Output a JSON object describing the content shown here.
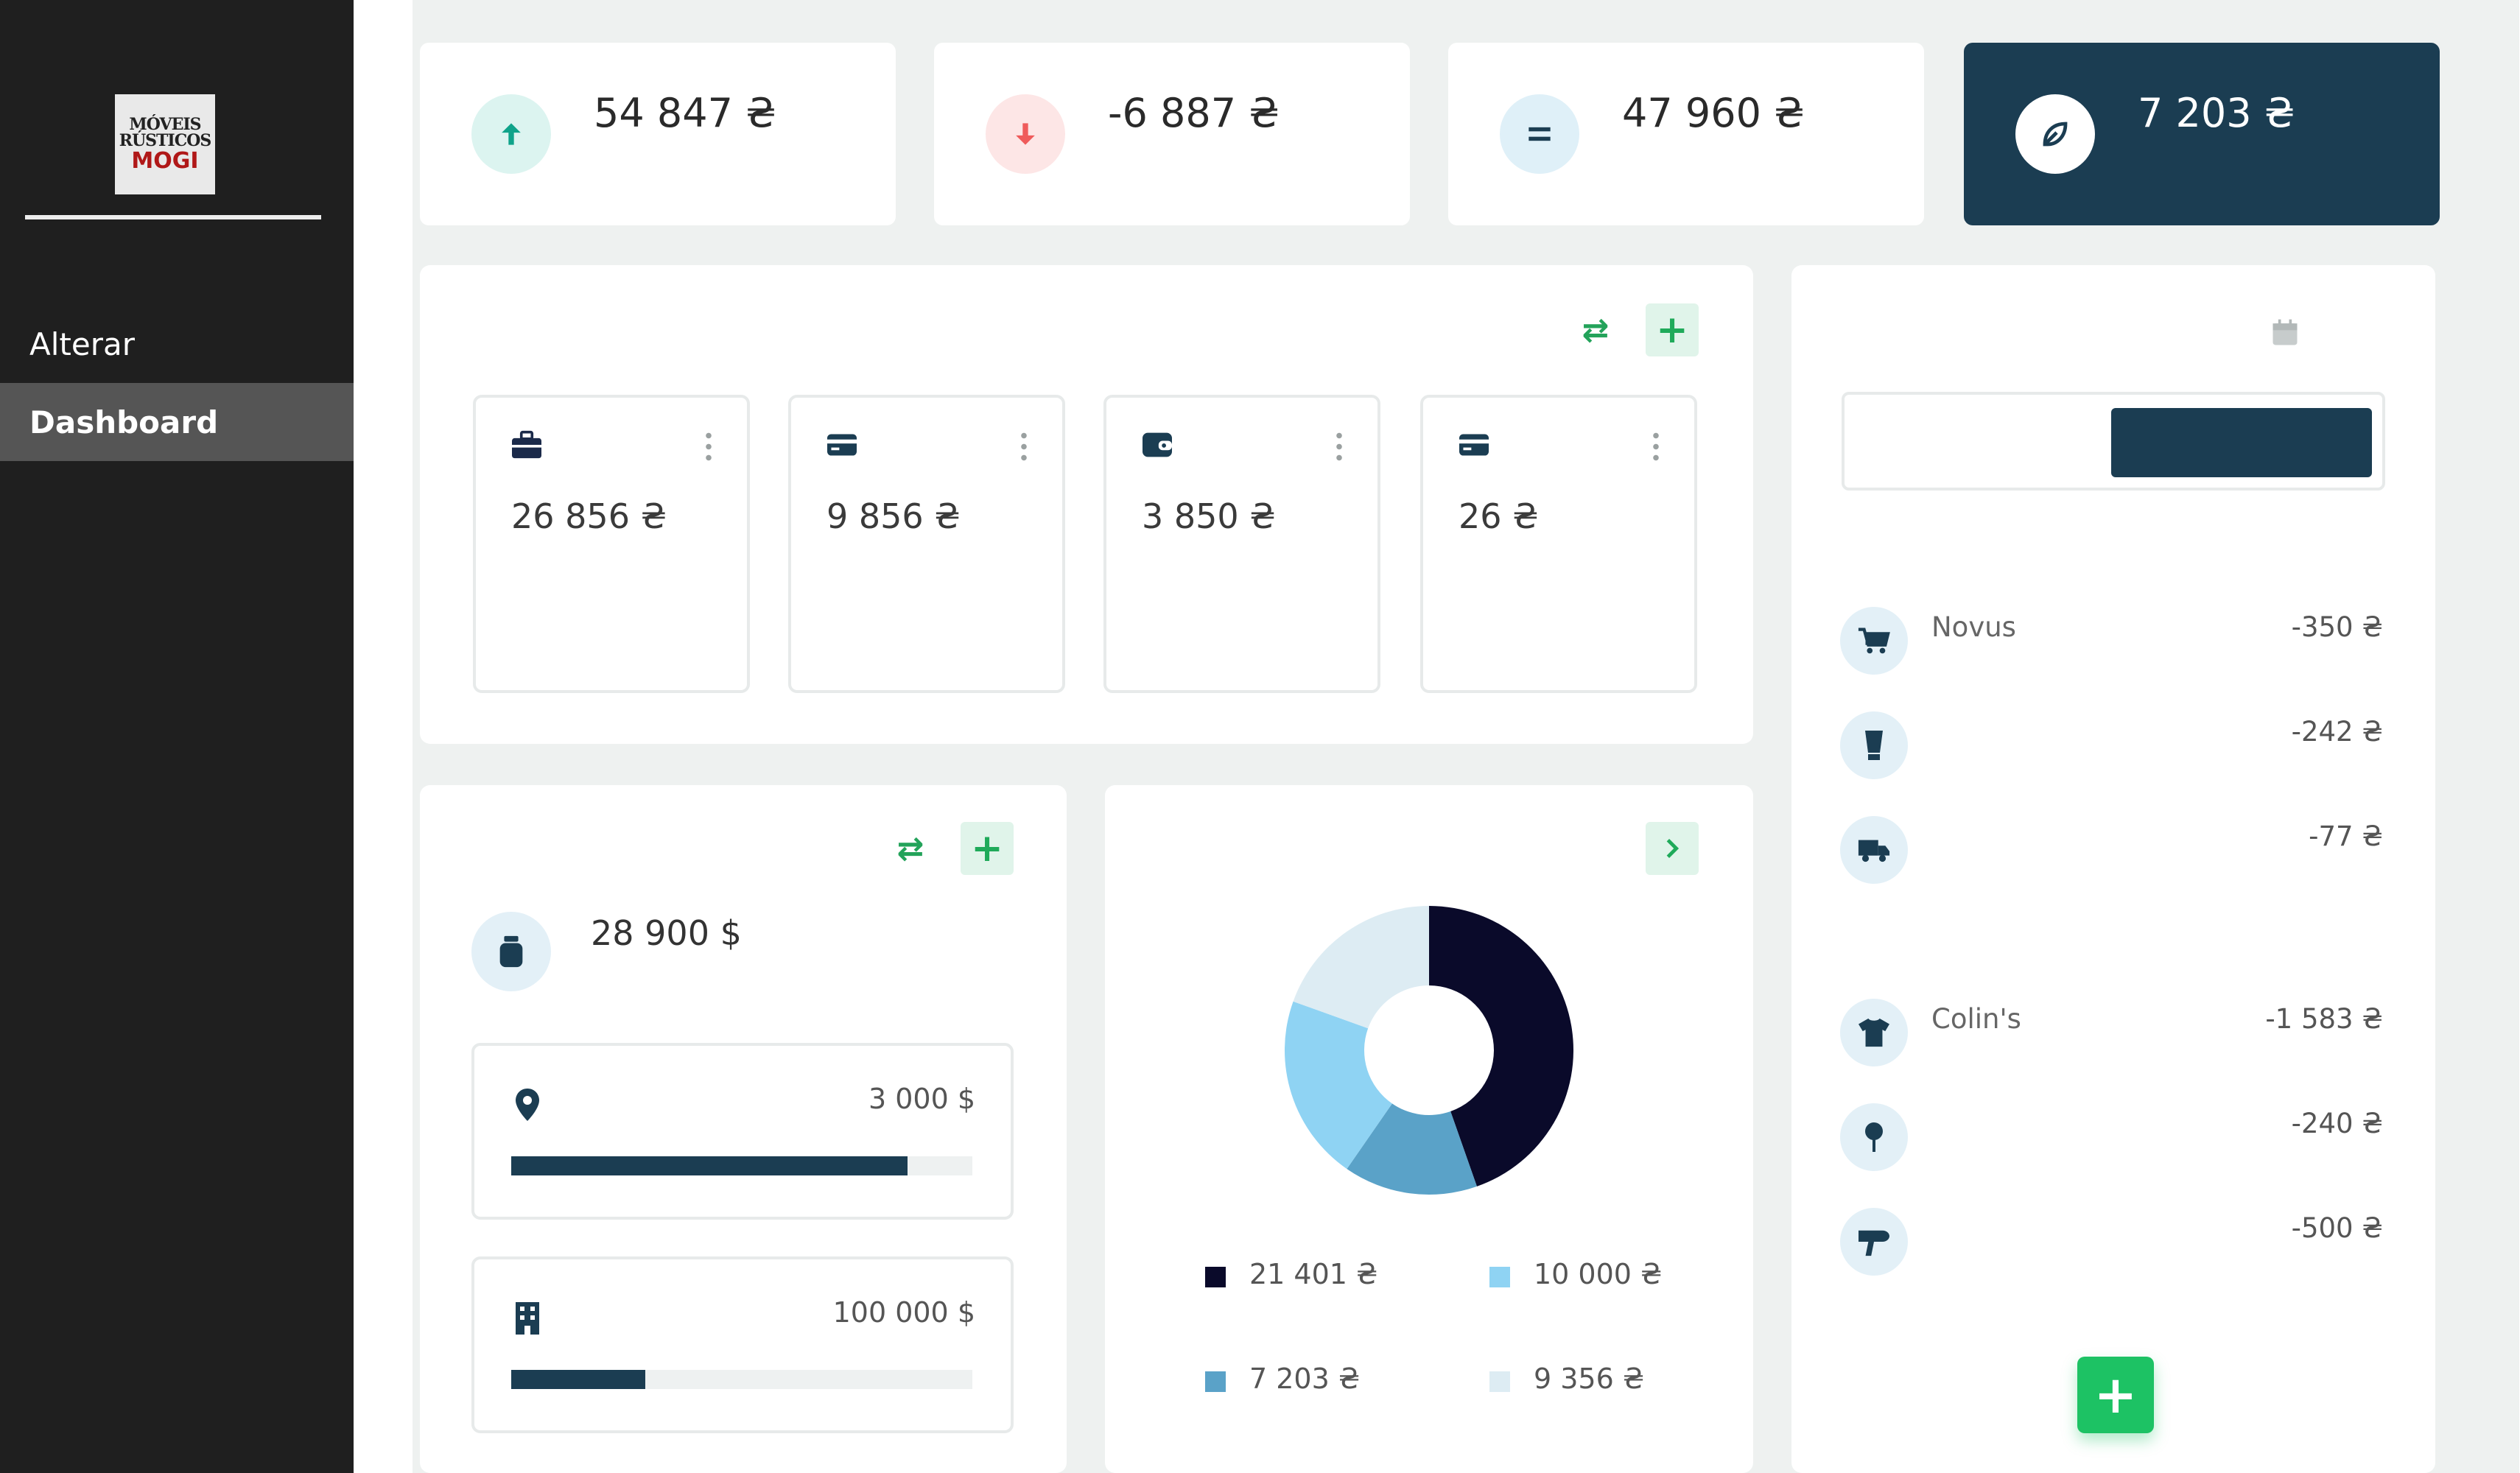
{
  "sidebar": {
    "logo": {
      "line1": "MÓVEIS",
      "line2": "RÚSTICOS",
      "line3": "MOGI"
    },
    "items": [
      {
        "label": "Alterar"
      },
      {
        "label": "Dashboard",
        "active": true
      }
    ]
  },
  "stats": [
    {
      "value": "54 847 ₴",
      "icon": "arrow-up-icon",
      "color": "#0fa38a"
    },
    {
      "value": "-6 887 ₴",
      "icon": "arrow-down-icon",
      "color": "#ef5b5b"
    },
    {
      "value": "47 960 ₴",
      "icon": "equals-icon",
      "color": "#1b3d52"
    },
    {
      "value": "7 203 ₴",
      "icon": "leaf-icon",
      "color": "#1b3d52"
    }
  ],
  "accounts": [
    {
      "icon": "briefcase-icon",
      "amount": "26 856 ₴"
    },
    {
      "icon": "card-icon",
      "amount": "9 856 ₴"
    },
    {
      "icon": "wallet-icon",
      "amount": "3 850 ₴"
    },
    {
      "icon": "card-icon",
      "amount": "26 ₴"
    }
  ],
  "savings": {
    "total": "28 900 $",
    "goals": [
      {
        "icon": "location-pin-icon",
        "amount": "3 000 $",
        "progress": 0.86
      },
      {
        "icon": "building-icon",
        "amount": "100 000 $",
        "progress": 0.29
      }
    ]
  },
  "chart_data": {
    "type": "pie",
    "labels": [
      "21 401 ₴",
      "7 203 ₴",
      "10 000 ₴",
      "9 356 ₴"
    ],
    "values": [
      21401,
      7203,
      10000,
      9356
    ],
    "colors": [
      "#0a0a2a",
      "#5aa2c8",
      "#8fd3f3",
      "#ddecf3"
    ],
    "donut": true
  },
  "transactions": {
    "groups": [
      [
        {
          "icon": "cart-icon",
          "name": "Novus",
          "amount": "-350 ₴"
        },
        {
          "icon": "cup-icon",
          "name": "",
          "amount": "-242 ₴"
        },
        {
          "icon": "truck-icon",
          "name": "",
          "amount": "-77 ₴"
        }
      ],
      [
        {
          "icon": "shirt-icon",
          "name": "Colin's",
          "amount": "-1 583 ₴"
        },
        {
          "icon": "pin-icon",
          "name": "",
          "amount": "-240 ₴"
        },
        {
          "icon": "hair-dryer-icon",
          "name": "",
          "amount": "-500 ₴"
        }
      ]
    ]
  },
  "fab": {
    "label": "+"
  }
}
